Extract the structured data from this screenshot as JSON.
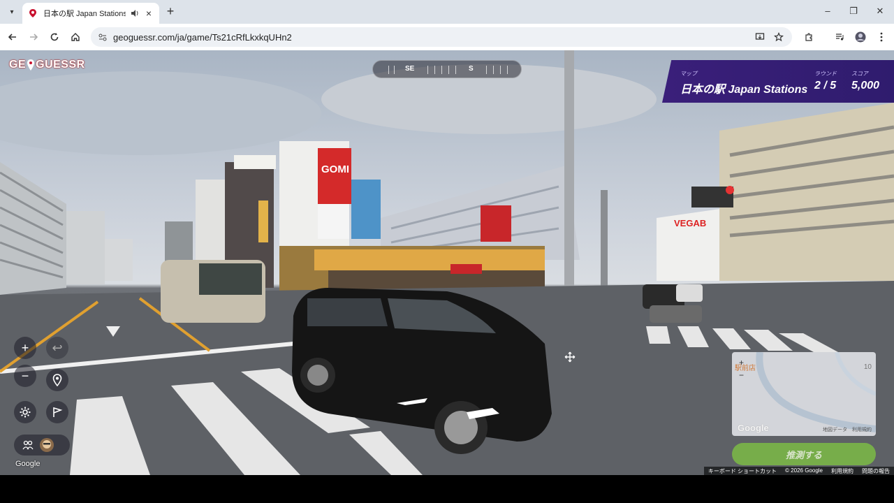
{
  "browser": {
    "tab_title": "日本の駅 Japan Stations - G",
    "tab_close": "×",
    "new_tab": "+",
    "url": "geoguessr.com/ja/game/Ts21cRfLkxkqUHn2",
    "window_min": "–",
    "window_max": "❐",
    "window_close": "✕"
  },
  "game": {
    "logo_left": "GE",
    "logo_right": "GUESSR",
    "compass": {
      "left": "SE",
      "right": "S"
    },
    "status": {
      "map_caption": "マップ",
      "map_value": "日本の駅 Japan Stations",
      "round_caption": "ラウンド",
      "round_value": "2 / 5",
      "score_caption": "スコア",
      "score_value": "5,000"
    },
    "controls": {
      "zoom_in": "+",
      "zoom_out": "−",
      "undo": "↩"
    },
    "google_watermark": "Google",
    "minimap": {
      "zoom_in": "+",
      "zoom_out": "−",
      "poi_label": "駅前店",
      "badge": "10",
      "google": "Google",
      "attribution": "地図データ　利用規約"
    },
    "guess_button": "推測する",
    "footer": {
      "shortcuts": "キーボード ショートカット",
      "copyright": "© 2026 Google",
      "terms": "利用規約",
      "report": "問題の報告"
    }
  },
  "colors": {
    "brand_red": "#c8102e",
    "status_purple": "#3a1f7a",
    "guess_green": "#7ab648"
  }
}
